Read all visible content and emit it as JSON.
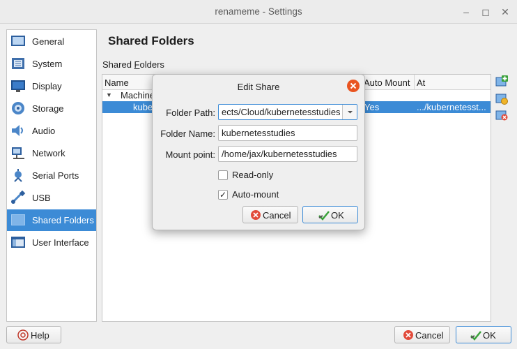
{
  "window": {
    "title": "renameme - Settings"
  },
  "sidebar": {
    "items": [
      {
        "label": "General",
        "icon": "general-icon"
      },
      {
        "label": "System",
        "icon": "system-icon"
      },
      {
        "label": "Display",
        "icon": "display-icon"
      },
      {
        "label": "Storage",
        "icon": "storage-icon"
      },
      {
        "label": "Audio",
        "icon": "audio-icon"
      },
      {
        "label": "Network",
        "icon": "network-icon"
      },
      {
        "label": "Serial Ports",
        "icon": "serial-ports-icon"
      },
      {
        "label": "USB",
        "icon": "usb-icon"
      },
      {
        "label": "Shared Folders",
        "icon": "shared-folders-icon",
        "selected": true
      },
      {
        "label": "User Interface",
        "icon": "user-interface-icon"
      }
    ]
  },
  "page": {
    "title": "Shared Folders",
    "group_label_prefix": "Shared ",
    "group_label_accel": "F",
    "group_label_rest": "olders"
  },
  "table": {
    "columns": [
      "Name",
      "Auto Mount",
      "At"
    ],
    "group_row": "Machine",
    "selected_row": {
      "name": "kube",
      "auto_mount": "Yes",
      "at": ".../kubernetesst..."
    }
  },
  "dialog": {
    "title": "Edit Share",
    "folder_path_label": "Folder Path:",
    "folder_path_value": "ects/Cloud/kubernetesstudies",
    "folder_name_label": "Folder Name:",
    "folder_name_value": "kubernetesstudies",
    "mount_point_label": "Mount point:",
    "mount_point_value": "/home/jax/kubernetesstudies",
    "readonly_label": "Read-only",
    "readonly_checked": false,
    "automount_label": "Auto-mount",
    "automount_checked": true,
    "cancel_label": "Cancel",
    "ok_label": "OK"
  },
  "footer": {
    "help_label": "Help",
    "cancel_label": "Cancel",
    "ok_label": "OK"
  },
  "colors": {
    "accent": "#3c8bd6",
    "close_red": "#e95420"
  }
}
